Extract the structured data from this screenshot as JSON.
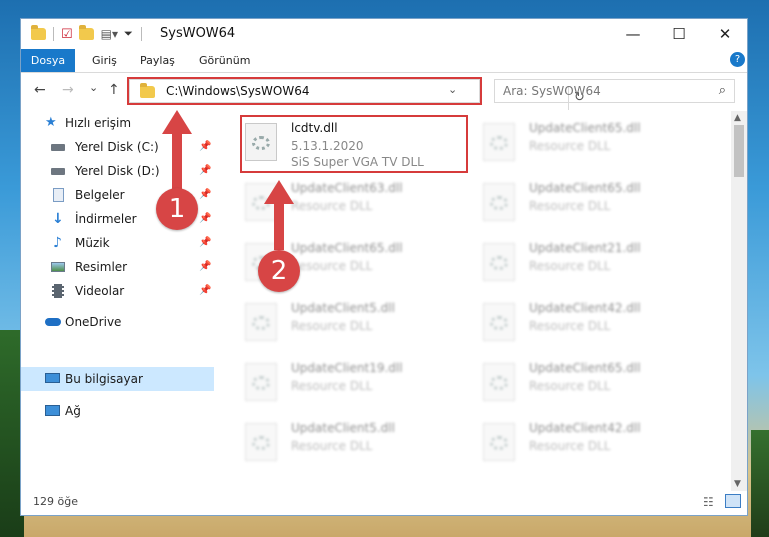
{
  "window": {
    "title": "SysWOW64",
    "minimize": "—",
    "maximize": "☐",
    "close": "✕",
    "help": "?"
  },
  "ribbon": {
    "tabs": [
      "Dosya",
      "Giriş",
      "Paylaş",
      "Görünüm"
    ]
  },
  "nav": {
    "back": "←",
    "forward": "→",
    "recent": "⌄",
    "up": "↑",
    "address": "C:\\Windows\\SysWOW64",
    "refresh": "↻",
    "search_placeholder": "Ara: SysWOW64"
  },
  "sidebar": {
    "items": [
      {
        "label": "Hızlı erişim",
        "icon": "star-icon"
      },
      {
        "label": "Yerel Disk (C:)",
        "icon": "drive-icon",
        "pinned": true
      },
      {
        "label": "Yerel Disk (D:)",
        "icon": "drive-icon",
        "pinned": true
      },
      {
        "label": "Belgeler",
        "icon": "documents-icon",
        "pinned": true
      },
      {
        "label": "İndirmeler",
        "icon": "download-icon",
        "pinned": true
      },
      {
        "label": "Müzik",
        "icon": "music-icon",
        "pinned": true
      },
      {
        "label": "Resimler",
        "icon": "pictures-icon",
        "pinned": true
      },
      {
        "label": "Videolar",
        "icon": "videos-icon",
        "pinned": true
      },
      {
        "label": "OneDrive",
        "icon": "cloud-icon"
      },
      {
        "label": "Bu bilgisayar",
        "icon": "computer-icon",
        "selected": true
      },
      {
        "label": "Ağ",
        "icon": "network-icon"
      }
    ]
  },
  "files": {
    "highlighted": {
      "name": "lcdtv.dll",
      "version": "5.13.1.2020",
      "description": "SiS Super VGA TV DLL"
    },
    "left_column": [
      {
        "name": "UpdateClient63.dll",
        "description": "Resource DLL"
      },
      {
        "name": "UpdateClient65.dll",
        "description": "Resource DLL"
      },
      {
        "name": "UpdateClient5.dll",
        "description": "Resource DLL"
      },
      {
        "name": "UpdateClient19.dll",
        "description": "Resource DLL"
      },
      {
        "name": "UpdateClient5.dll",
        "description": "Resource DLL"
      }
    ],
    "right_column": [
      {
        "name": "UpdateClient65.dll",
        "description": "Resource DLL"
      },
      {
        "name": "UpdateClient65.dll",
        "description": "Resource DLL"
      },
      {
        "name": "UpdateClient21.dll",
        "description": "Resource DLL"
      },
      {
        "name": "UpdateClient42.dll",
        "description": "Resource DLL"
      },
      {
        "name": "UpdateClient65.dll",
        "description": "Resource DLL"
      },
      {
        "name": "UpdateClient42.dll",
        "description": "Resource DLL"
      }
    ]
  },
  "status": {
    "item_count": "129 öğe"
  },
  "annotations": {
    "step1": "1",
    "step2": "2",
    "color": "#d74545"
  }
}
